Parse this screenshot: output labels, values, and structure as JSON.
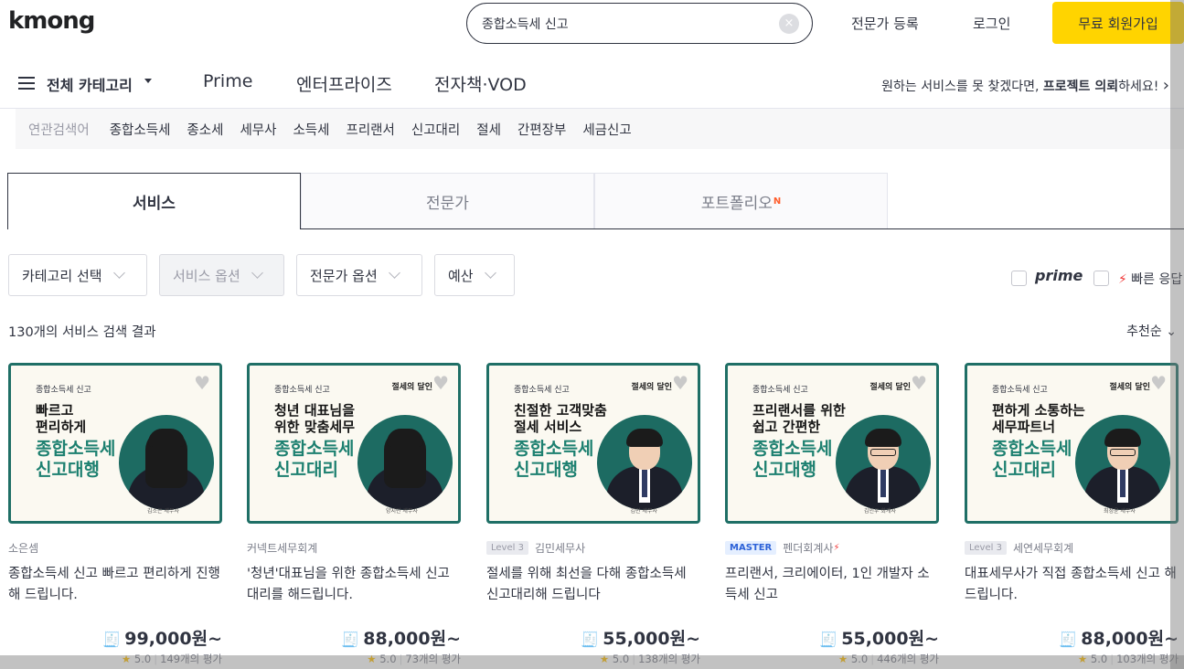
{
  "header": {
    "logo": "kmong",
    "search_value": "종합소득세 신고",
    "clear_icon": "×",
    "register_expert": "전문가 등록",
    "login": "로그인",
    "signup": "무료 회원가입"
  },
  "nav": {
    "all_categories": "전체 카테고리",
    "items": [
      "Prime",
      "엔터프라이즈",
      "전자책·VOD"
    ],
    "promo_prefix": "원하는 서비스를 못 찾겠다면, ",
    "promo_bold": "프로젝트 의뢰",
    "promo_suffix": "하세요!",
    "promo_arrow": "›"
  },
  "related": {
    "label": "연관검색어",
    "keywords": [
      "종합소득세",
      "종소세",
      "세무사",
      "소득세",
      "프리랜서",
      "신고대리",
      "절세",
      "간편장부",
      "세금신고"
    ]
  },
  "tabs": [
    {
      "label": "서비스",
      "badge": ""
    },
    {
      "label": "전문가",
      "badge": ""
    },
    {
      "label": "포트폴리오",
      "badge": "N"
    }
  ],
  "filters": [
    {
      "label": "카테고리 선택"
    },
    {
      "label": "서비스 옵션"
    },
    {
      "label": "전문가 옵션"
    },
    {
      "label": "예산"
    }
  ],
  "toggles": {
    "prime": "prime",
    "fast": "빠른 응답"
  },
  "results": {
    "count_text": "130개의 서비스 검색 결과",
    "sort": "추천순"
  },
  "colors": {
    "accent": "#ffd400",
    "thumb_border": "#1f6f66",
    "thumb_green": "#1d8070"
  },
  "cards": [
    {
      "thumb_tag": "종합소득세 신고",
      "thumb_brand": "",
      "thumb_line1": "빠르고\n편리하게",
      "thumb_line2": "종합소득세\n신고대행",
      "thumb_sig": "김소은 세무사",
      "level_badge": "",
      "master_badge": "",
      "seller": "소은셈",
      "fast": "",
      "title": "종합소득세 신고 빠르고 편리하게 진행해 드립니다.",
      "price": "99,000원~",
      "rating": "5.0",
      "reviews": "149개의 평가"
    },
    {
      "thumb_tag": "종합소득세 신고",
      "thumb_brand": "절세의 달인",
      "thumb_line1": "청년 대표님을\n위한 맞춤세무",
      "thumb_line2": "종합소득세\n신고대리",
      "thumb_sig": "양지민 세무사",
      "level_badge": "",
      "master_badge": "",
      "seller": "커넥트세무회계",
      "fast": "",
      "title": "'청년'대표님을 위한 종합소득세 신고대리를 해드립니다.",
      "price": "88,000원~",
      "rating": "5.0",
      "reviews": "73개의 평가"
    },
    {
      "thumb_tag": "종합소득세 신고",
      "thumb_brand": "절세의 달인",
      "thumb_line1": "친절한 고객맞춤\n절세 서비스",
      "thumb_line2": "종합소득세\n신고대행",
      "thumb_sig": "김민 세무사",
      "level_badge": "Level 3",
      "master_badge": "",
      "seller": "김민세무사",
      "fast": "",
      "title": "절세를 위해 최선을 다해 종합소득세 신고대리해 드립니다",
      "price": "55,000원~",
      "rating": "5.0",
      "reviews": "138개의 평가"
    },
    {
      "thumb_tag": "종합소득세 신고",
      "thumb_brand": "절세의 달인",
      "thumb_line1": "프리랜서를 위한\n쉽고 간편한",
      "thumb_line2": "종합소득세\n신고대행",
      "thumb_sig": "김인우 회계사",
      "level_badge": "",
      "master_badge": "MASTER",
      "seller": "펜더회계사",
      "fast": "⚡",
      "title": "프리랜서, 크리에이터, 1인 개발자 소득세 신고",
      "price": "55,000원~",
      "rating": "5.0",
      "reviews": "446개의 평가"
    },
    {
      "thumb_tag": "종합소득세 신고",
      "thumb_brand": "절세의 달인",
      "thumb_line1": "편하게 소통하는\n세무파트너",
      "thumb_line2": "종합소득세\n신고대리",
      "thumb_sig": "최정윤 세무사",
      "level_badge": "Level 3",
      "master_badge": "",
      "seller": "세연세무회계",
      "fast": "",
      "title": "대표세무사가 직접 종합소득세 신고 해 드립니다.",
      "price": "88,000원~",
      "rating": "5.0",
      "reviews": "103개의 평가"
    }
  ]
}
